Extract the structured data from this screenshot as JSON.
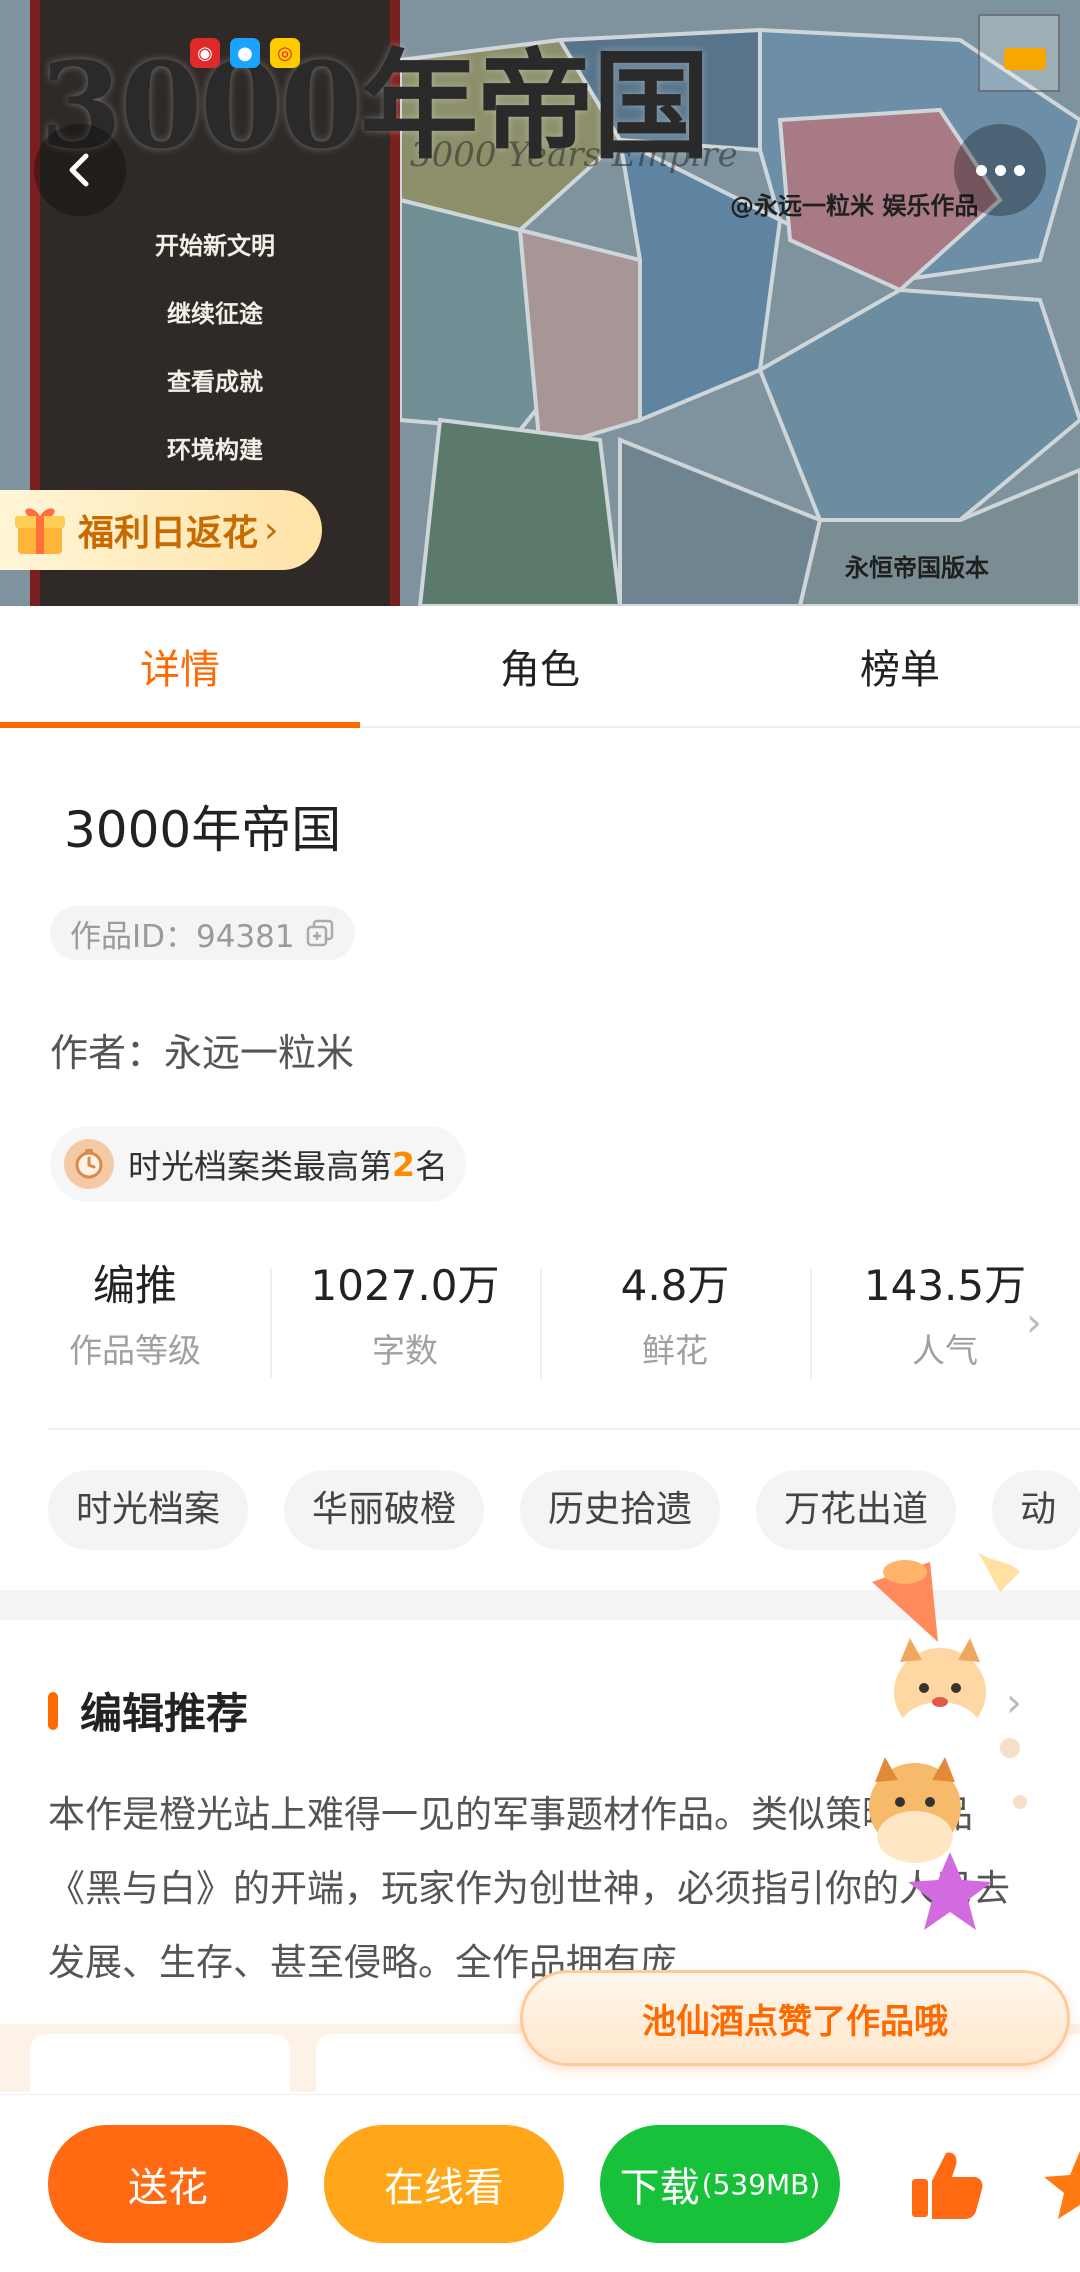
{
  "banner": {
    "title": "3000年帝国",
    "subtitle": "3000 Years Empire",
    "credit": "@永远一粒米 娱乐作品",
    "version": "永恒帝国版本",
    "menu": [
      "开始新文明",
      "继续征途",
      "查看成就",
      "环境构建"
    ],
    "welfare_label": "福利日返花",
    "corner_logo": "3000年帝国"
  },
  "tabs": [
    {
      "label": "详情",
      "active": true
    },
    {
      "label": "角色",
      "active": false
    },
    {
      "label": "榜单",
      "active": false
    }
  ],
  "work": {
    "title": "3000年帝国",
    "id_text": "作品ID：94381",
    "author_text": "作者：永远一粒米",
    "rank_prefix": "时光档案类最高第",
    "rank_number": "2",
    "rank_suffix": "名"
  },
  "stats": [
    {
      "value": "编推",
      "label": "作品等级"
    },
    {
      "value": "1027.0万",
      "label": "字数"
    },
    {
      "value": "4.8万",
      "label": "鲜花"
    },
    {
      "value": "143.5万",
      "label": "人气"
    }
  ],
  "tags": [
    "时光档案",
    "华丽破橙",
    "历史拾遗",
    "万花出道",
    "动"
  ],
  "recommendation": {
    "title": "编辑推荐",
    "body": "本作是橙光站上难得一见的军事题材作品。类似策略作品《黑与白》的开端，玩家作为创世神，必须指引你的人民去发展、生存、甚至侵略。全作品拥有庞…"
  },
  "toast": "池仙酒点赞了作品哦",
  "bottom": {
    "flower": "送花",
    "read": "在线看",
    "download": "下载",
    "download_size": "(539MB)"
  },
  "colors": {
    "accent": "#ff6a00",
    "flower_button": "#ff6a12",
    "read_button": "#ffa619",
    "download_button": "#17c23a"
  }
}
